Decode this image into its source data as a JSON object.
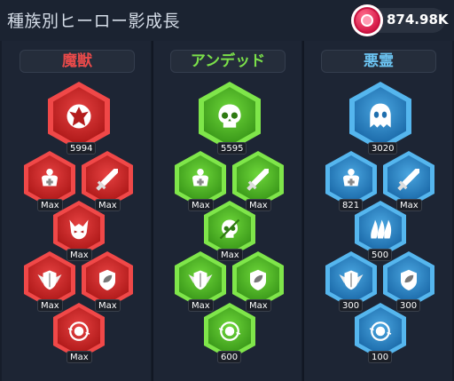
{
  "header": {
    "title": "種族別ヒーロー影成長"
  },
  "currency": {
    "amount": "874.98K",
    "icon": "chip-icon"
  },
  "columns": [
    {
      "name": "魔獣",
      "color": "#e84a4a",
      "theme": "red",
      "nodes": [
        {
          "icon": "demon-crest-icon",
          "value": "5994"
        },
        {
          "icon": "health-figure-icon",
          "value": "Max"
        },
        {
          "icon": "sword-icon",
          "value": "Max"
        },
        {
          "icon": "demon-face-icon",
          "value": "Max"
        },
        {
          "icon": "shield-wings-icon",
          "value": "Max"
        },
        {
          "icon": "shield-leaf-icon",
          "value": "Max"
        },
        {
          "icon": "energy-orb-icon",
          "value": "Max"
        }
      ]
    },
    {
      "name": "アンデッド",
      "color": "#7be04a",
      "theme": "green",
      "nodes": [
        {
          "icon": "skull-icon",
          "value": "5595"
        },
        {
          "icon": "health-figure-icon",
          "value": "Max"
        },
        {
          "icon": "sword-icon",
          "value": "Max"
        },
        {
          "icon": "skull-slash-icon",
          "value": "Max"
        },
        {
          "icon": "shield-wings-icon",
          "value": "Max"
        },
        {
          "icon": "shield-leaf-icon",
          "value": "Max"
        },
        {
          "icon": "energy-orb-icon",
          "value": "600"
        }
      ]
    },
    {
      "name": "悪霊",
      "color": "#6cc4f2",
      "theme": "blue",
      "nodes": [
        {
          "icon": "ghost-icon",
          "value": "3020"
        },
        {
          "icon": "health-figure-icon",
          "value": "821"
        },
        {
          "icon": "sword-icon",
          "value": "Max"
        },
        {
          "icon": "spirit-flames-icon",
          "value": "500"
        },
        {
          "icon": "shield-wings-icon",
          "value": "300"
        },
        {
          "icon": "shield-leaf-icon",
          "value": "300"
        },
        {
          "icon": "energy-orb-icon",
          "value": "100"
        }
      ]
    }
  ]
}
